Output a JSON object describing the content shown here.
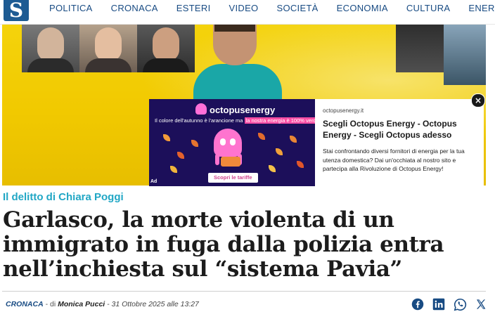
{
  "site": {
    "logo_letter": "S"
  },
  "nav": {
    "items": [
      "POLITICA",
      "CRONACA",
      "ESTERI",
      "VIDEO",
      "SOCIETÀ",
      "ECONOMIA",
      "CULTURA",
      "ENERGIA"
    ]
  },
  "ad": {
    "brand": "octopusenergy",
    "tagline_pre": "Il colore dell'autunno è l'arancione ma",
    "tagline_highlight": "la nostra energia è 100% verde!",
    "cta": "Scopri le tariffe",
    "label": "Ad",
    "domain": "octopusenergy.it",
    "headline": "Scegli Octopus Energy - Octopus Energy - Scegli Octopus adesso",
    "description": "Stai confrontando diversi fornitori di energia per la tua utenza domestica? Dai un'occhiata al nostro sito e partecipa alla Rivoluzione di Octopus Energy!",
    "close_glyph": "×"
  },
  "article": {
    "kicker": "Il delitto di Chiara Poggi",
    "headline": "Garlasco, la morte violenta di un immigrato in fuga dalla polizia entra nell’inchiesta sul “sistema Pavia”",
    "section": "CRONACA",
    "sep1": " - di ",
    "author": "Monica Pucci",
    "sep2": " - ",
    "date": "31 Ottobre 2025 alle 13:27"
  },
  "share": {
    "icons": [
      "facebook-icon",
      "linkedin-icon",
      "whatsapp-icon",
      "x-icon"
    ]
  },
  "colors": {
    "brand": "#184b83",
    "kicker": "#21a7c5",
    "ad_bg": "#1c0f5a",
    "ad_accent": "#ff4ea5"
  }
}
